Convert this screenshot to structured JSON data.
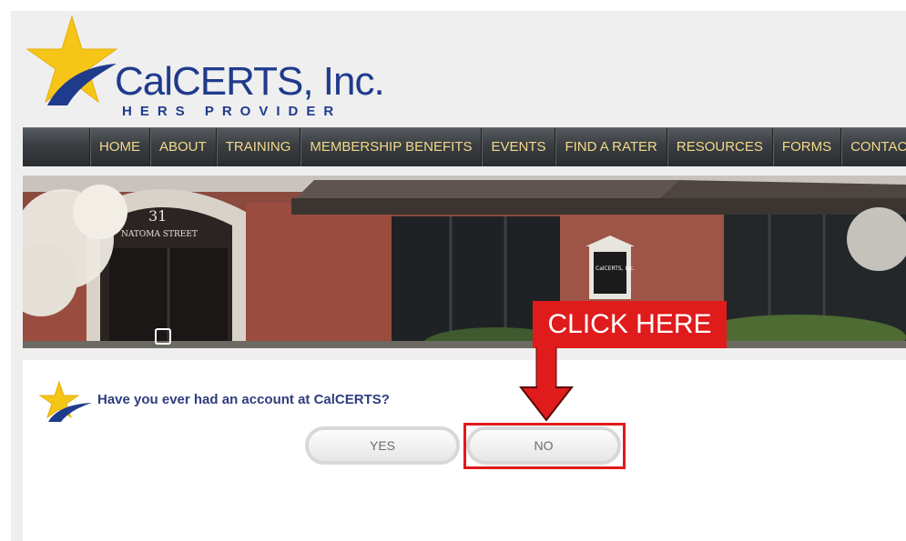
{
  "logo": {
    "name": "CalCERTS, Inc.",
    "tagline": "HERS PROVIDER",
    "icon": "star-logo-icon"
  },
  "nav": {
    "items": [
      {
        "label": "HOME"
      },
      {
        "label": "ABOUT"
      },
      {
        "label": "TRAINING"
      },
      {
        "label": "MEMBERSHIP BENEFITS"
      },
      {
        "label": "EVENTS"
      },
      {
        "label": "FIND A RATER"
      },
      {
        "label": "RESOURCES"
      },
      {
        "label": "FORMS"
      },
      {
        "label": "CONTACT US"
      }
    ]
  },
  "banner": {
    "address_number": "31",
    "street_sign": "NATOMA STREET",
    "plaque": "CalCERTS, Inc."
  },
  "main": {
    "question": "Have you ever had an account at CalCERTS?",
    "yes_label": "YES",
    "no_label": "NO"
  },
  "annotation": {
    "callout": "CLICK HERE",
    "color": "#e01b1b"
  },
  "colors": {
    "brand_blue": "#1f3b8c",
    "star_yellow": "#f5c518",
    "nav_text": "#f2d98a"
  }
}
